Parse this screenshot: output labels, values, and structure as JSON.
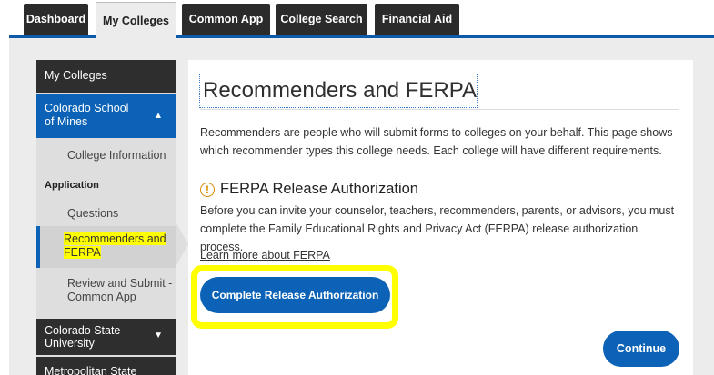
{
  "tabs": [
    {
      "label": "Dashboard"
    },
    {
      "label": "My Colleges"
    },
    {
      "label": "Common App"
    },
    {
      "label": "College Search"
    },
    {
      "label": "Financial Aid"
    }
  ],
  "sidebar": {
    "header": "My Colleges",
    "college1": "Colorado School of Mines",
    "college_info": "College Information",
    "application_heading": "Application",
    "questions": "Questions",
    "recommenders": "Recommenders and FERPA",
    "review_submit": "Review and Submit - Common App",
    "college2": "Colorado State University",
    "college3": "Metropolitan State"
  },
  "main": {
    "title": "Recommenders and FERPA",
    "intro": "Recommenders are people who will submit forms to colleges on your behalf. This page shows which recommender types this college needs. Each college will have different requirements.",
    "ferpa_heading": "FERPA Release Authorization",
    "ferpa_text": "Before you can invite your counselor, teachers, recommenders, parents, or advisors, you must complete the Family Educational Rights and Privacy Act (FERPA) release authorization process.",
    "learn_link": "Learn more about FERPA",
    "complete_button": "Complete Release Authorization",
    "continue_button": "Continue"
  },
  "colors": {
    "accent_blue": "#0b62b6",
    "dark": "#2e2e2e",
    "highlight": "#ffff00",
    "warning": "#d88a00"
  }
}
